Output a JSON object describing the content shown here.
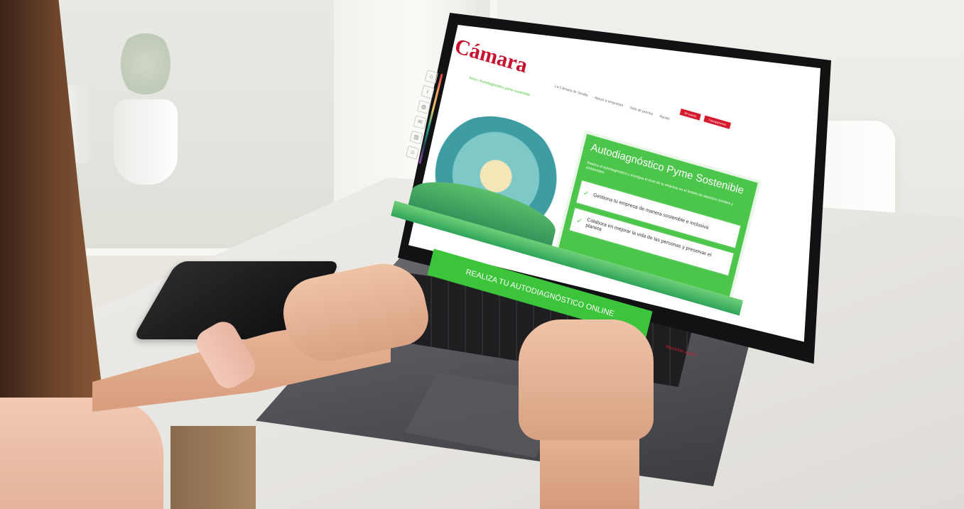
{
  "brand": {
    "logo_text": "Cámara",
    "accent": "#c8102e",
    "green": "#4cc64a"
  },
  "site": {
    "nav": [
      "La Cámara de Sevilla",
      "Apoyo a empresas",
      "Sala de prensa",
      "Ayuda"
    ],
    "top_buttons": [
      "Mi cuenta",
      "Transparencia"
    ],
    "breadcrumb": "Inicio / Autodiagnóstico pyme sostenible",
    "sidebar_icons": [
      "home-icon",
      "info-icon",
      "globe-icon",
      "mail-icon",
      "chart-icon",
      "user-icon"
    ]
  },
  "card": {
    "title": "Autodiagnóstico Pyme Sostenible",
    "text": "Realiza el autodiagnóstico y averigua el nivel de tu empresa en el ámbito de aspectos sociales y ambientales",
    "checks": [
      "Gestiona tu empresa de manera sostenible e inclusiva",
      "Colabora en mejorar la vida de las personas y preservar el planeta"
    ]
  },
  "cta_label": "REALIZA TU AUTODIAGNÓSTICO ONLINE",
  "help_label": "Necesitas ayuda"
}
